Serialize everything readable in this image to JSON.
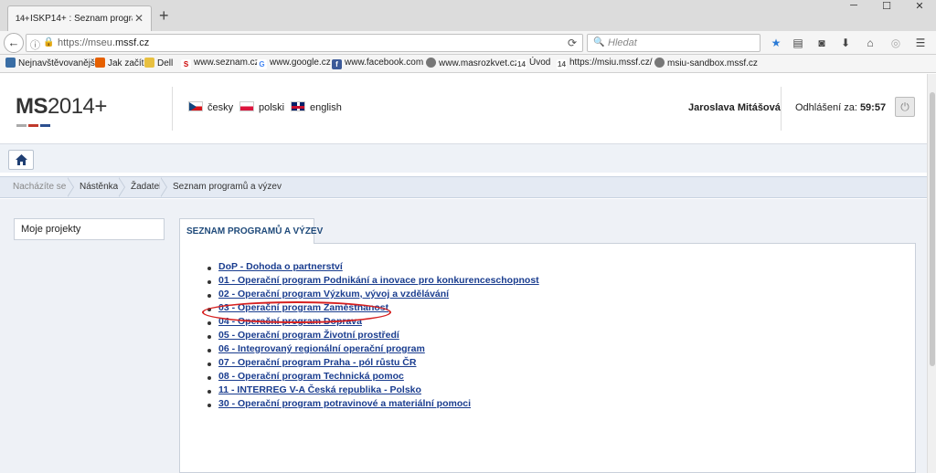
{
  "browser": {
    "tab_title": "ISKP14+ : Seznam progra...",
    "tab_favicon": "14+",
    "url_prefix": "https://mseu.",
    "url_domain": "mssf.cz",
    "search_placeholder": "Hledat",
    "bookmarks": [
      {
        "label": "Nejnavštěvovanější",
        "icon": "bookmark-icon",
        "color": "#3a6ea5"
      },
      {
        "label": "Jak začít",
        "icon": "firefox-icon",
        "color": "#e66000"
      },
      {
        "label": "Dell",
        "icon": "folder-icon",
        "color": "#e8c040"
      },
      {
        "label": "www.seznam.cz",
        "icon": "seznam-icon",
        "color": "#cc0000"
      },
      {
        "label": "www.google.cz",
        "icon": "google-icon",
        "color": "#4285f4"
      },
      {
        "label": "www.facebook.com",
        "icon": "facebook-icon",
        "color": "#3b5998"
      },
      {
        "label": "www.masrozkvet.cz",
        "icon": "globe-icon",
        "color": "#555555"
      },
      {
        "label": "Úvod",
        "icon": "ms14-icon",
        "color": "#555555"
      },
      {
        "label": "https://msiu.mssf.cz/",
        "icon": "ms14-icon",
        "color": "#555555"
      },
      {
        "label": "msiu-sandbox.mssf.cz",
        "icon": "globe-icon",
        "color": "#555555"
      }
    ]
  },
  "header": {
    "logo_ms": "MS",
    "logo_rest": "2014+",
    "languages": [
      {
        "label": "česky",
        "flag": "cz"
      },
      {
        "label": "polski",
        "flag": "pl"
      },
      {
        "label": "english",
        "flag": "en"
      }
    ],
    "user_name": "Jaroslava Mitášová",
    "logout_label": "Odhlášení za:",
    "logout_time": "59:57"
  },
  "breadcrumb": {
    "label": "Nacházíte se:",
    "items": [
      "Nástěnka",
      "Žadatel",
      "Seznam programů a výzev"
    ]
  },
  "sidebar": {
    "my_projects": "Moje projekty"
  },
  "panel": {
    "tab_title": "SEZNAM PROGRAMŮ A VÝZEV",
    "programs": [
      "DoP - Dohoda o partnerství",
      "01 - Operační program Podnikání a inovace pro konkurenceschopnost",
      "02 - Operační program Výzkum, vývoj a vzdělávání",
      "03 - Operační program Zaměstnanost",
      "04 - Operační program Doprava",
      "05 - Operační program Životní prostředí",
      "06 - Integrovaný regionální operační program",
      "07 - Operační program Praha - pól růstu ČR",
      "08 - Operační program Technická pomoc",
      "11 - INTERREG V-A Česká republika - Polsko",
      "30 - Operační program potravinové a materiální pomoci"
    ],
    "highlighted_index": 3
  },
  "colors": {
    "link": "#1a3d8f",
    "highlight": "#d62020",
    "panel_title": "#1f4a7a"
  }
}
